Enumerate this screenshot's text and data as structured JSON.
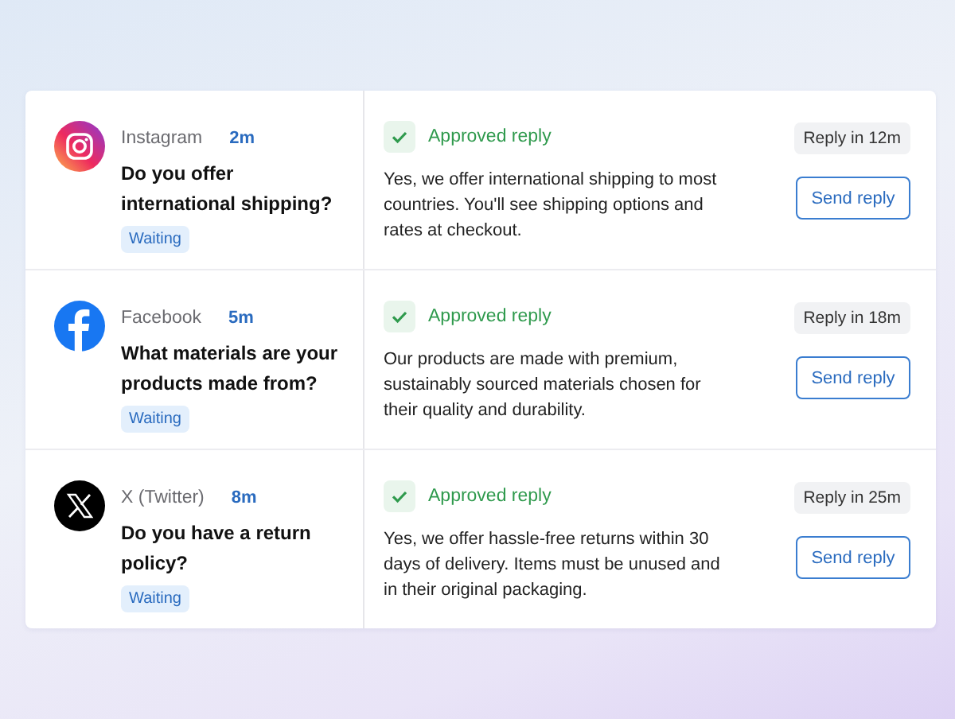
{
  "messages": [
    {
      "kind": "instagram",
      "source": "Instagram",
      "age": "2m",
      "question": "Do you offer international shipping?",
      "status": "Waiting",
      "approval": "Approved reply",
      "reply": "Yes, we offer international shipping to most countries. You'll see shipping options and rates at checkout.",
      "timer": "Reply in 12m",
      "action": "Send reply"
    },
    {
      "kind": "facebook",
      "source": "Facebook",
      "age": "5m",
      "question": "What materials are your products made from?",
      "status": "Waiting",
      "approval": "Approved reply",
      "reply": "Our products are made with premium, sustainably sourced materials chosen for their quality and durability.",
      "timer": "Reply in 18m",
      "action": "Send reply"
    },
    {
      "kind": "x",
      "source": "X (Twitter)",
      "age": "8m",
      "question": "Do you have a return policy?",
      "status": "Waiting",
      "approval": "Approved reply",
      "reply": "Yes, we offer hassle-free returns within 30 days of delivery. Items must be unused and in their original packaging.",
      "timer": "Reply in 25m",
      "action": "Send reply"
    }
  ]
}
